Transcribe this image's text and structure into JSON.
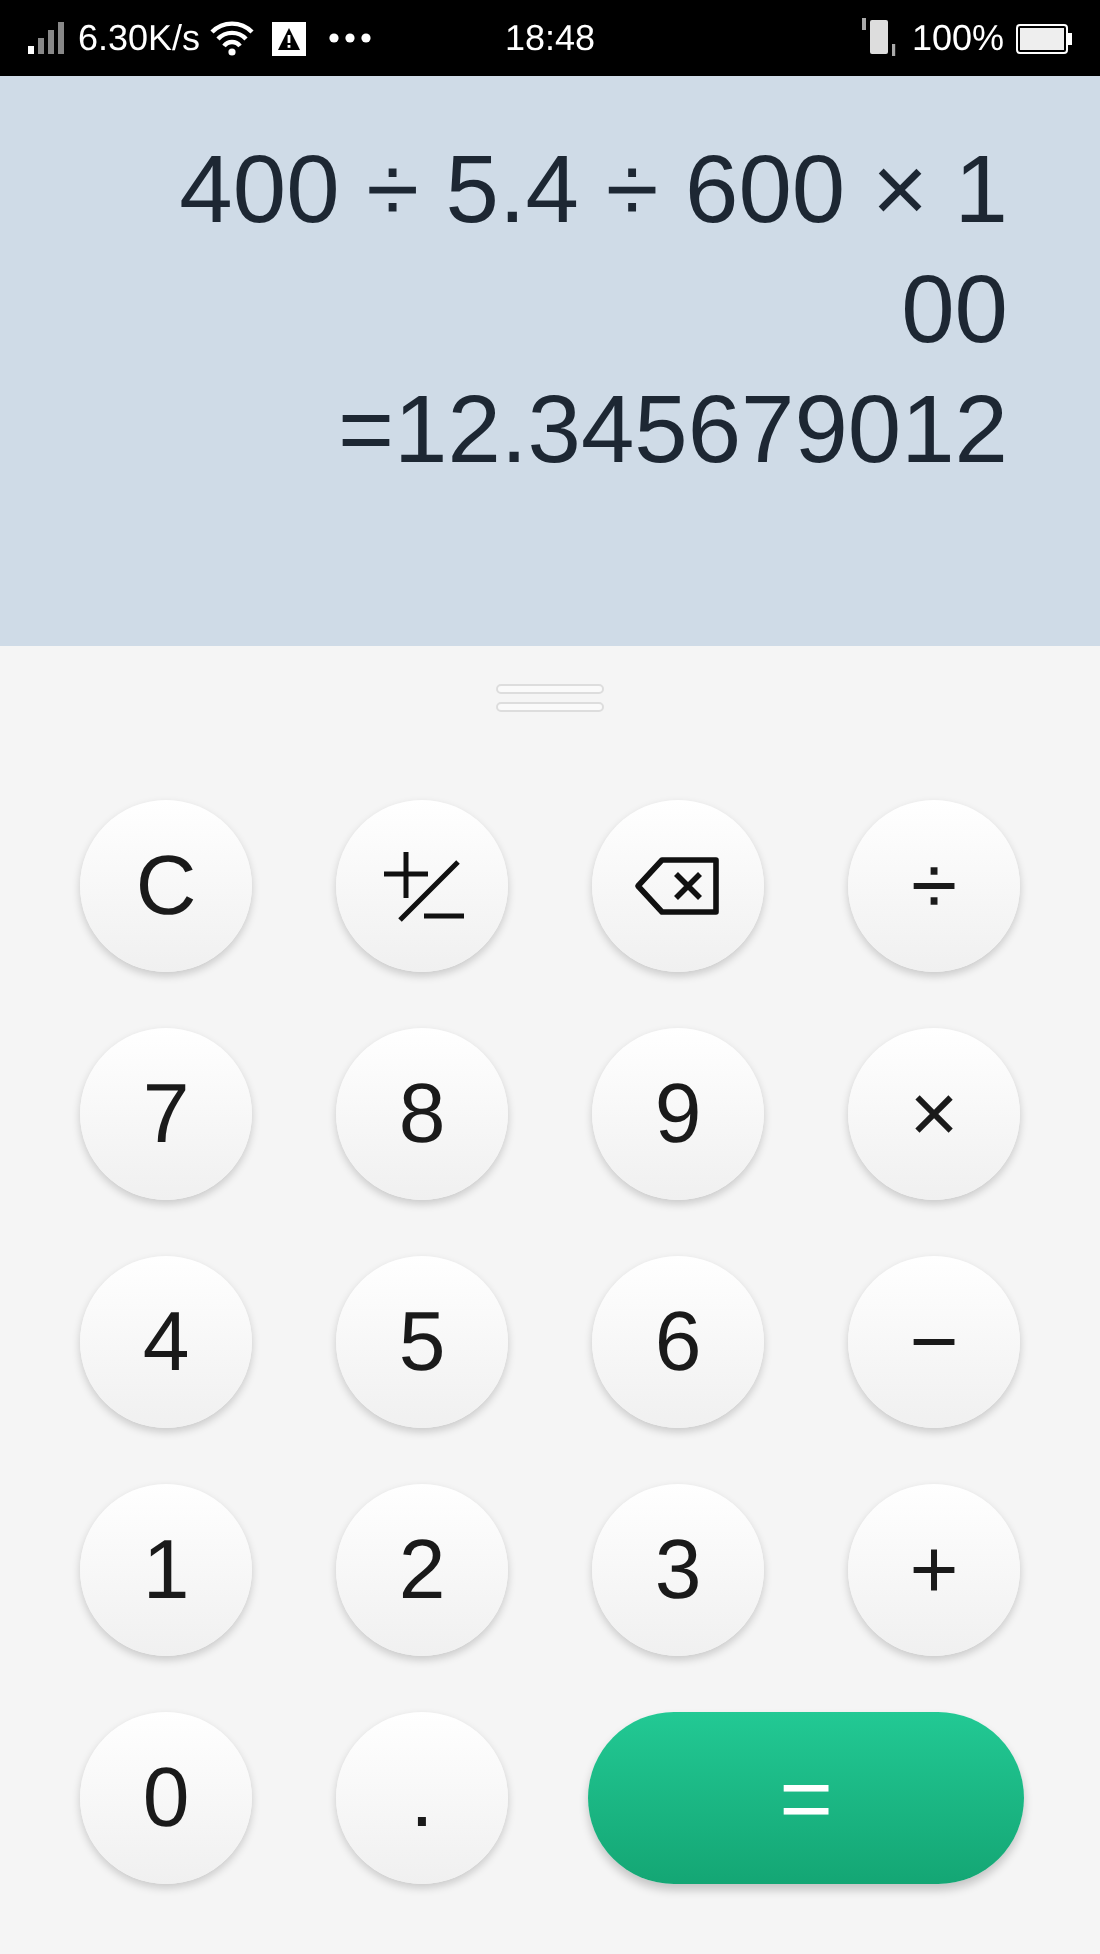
{
  "status_bar": {
    "network_speed": "6.30K/s",
    "time": "18:48",
    "battery": "100%"
  },
  "display": {
    "expression_lines": [
      "400 ÷ 5.4 ÷ 600 × 1",
      "00"
    ],
    "result": "=12.345679012"
  },
  "keys": [
    {
      "kind": "text",
      "label": "C"
    },
    {
      "kind": "plus-minus"
    },
    {
      "kind": "backspace"
    },
    {
      "kind": "text",
      "label": "÷"
    },
    {
      "kind": "text",
      "label": "7"
    },
    {
      "kind": "text",
      "label": "8"
    },
    {
      "kind": "text",
      "label": "9"
    },
    {
      "kind": "text",
      "label": "×"
    },
    {
      "kind": "text",
      "label": "4"
    },
    {
      "kind": "text",
      "label": "5"
    },
    {
      "kind": "text",
      "label": "6"
    },
    {
      "kind": "text",
      "label": "−"
    },
    {
      "kind": "text",
      "label": "1"
    },
    {
      "kind": "text",
      "label": "2"
    },
    {
      "kind": "text",
      "label": "3"
    },
    {
      "kind": "text",
      "label": "+"
    },
    {
      "kind": "text",
      "label": "0"
    },
    {
      "kind": "text",
      "label": "."
    },
    {
      "kind": "equals",
      "label": "="
    }
  ]
}
